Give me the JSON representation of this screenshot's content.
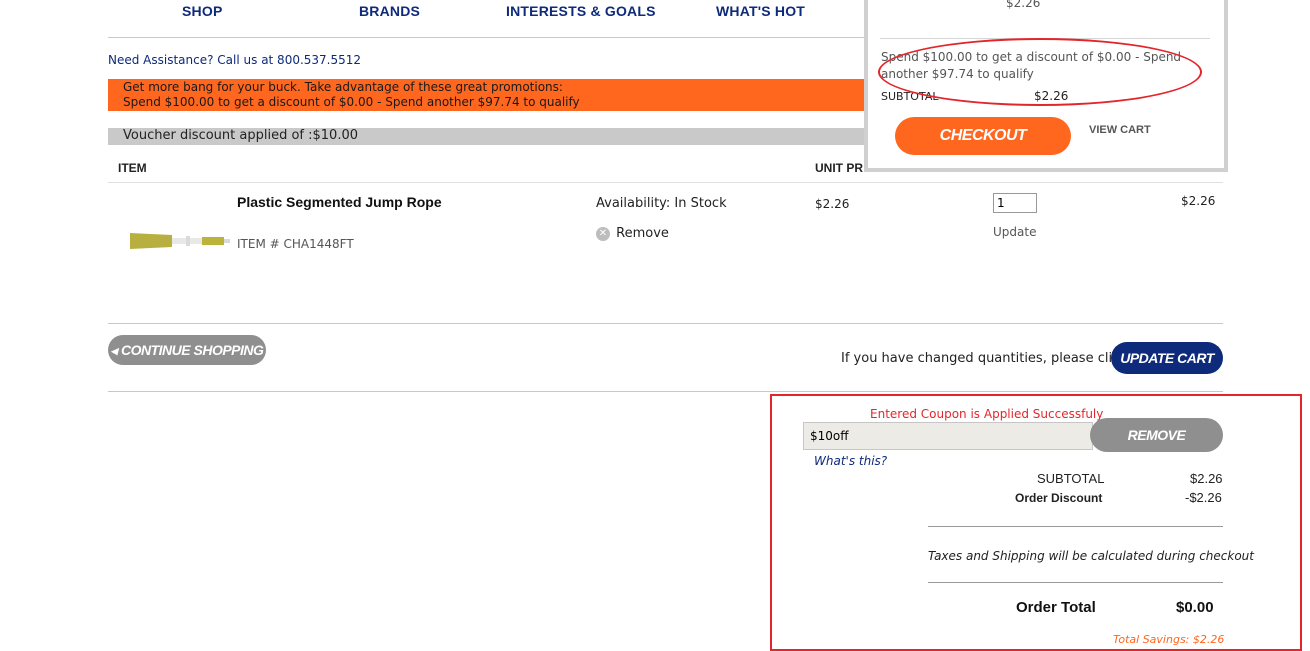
{
  "nav": {
    "items": [
      "SHOP",
      "BRANDS",
      "INTERESTS & GOALS",
      "WHAT'S HOT"
    ]
  },
  "assist": "Need Assistance? Call us at 800.537.5512",
  "promo": {
    "line1": "Get more bang for your buck. Take advantage of these great promotions:",
    "line2": "Spend $100.00 to get a discount of $0.00 - Spend another $97.74 to qualify"
  },
  "voucher_text": "Voucher discount applied of :$10.00",
  "table": {
    "col_item": "ITEM",
    "col_unit": "UNIT PR",
    "col_qty": "-"
  },
  "cart_item": {
    "name": "Plastic Segmented Jump Rope",
    "item_no": "ITEM # CHA1448FT",
    "availability": "Availability: In Stock",
    "remove": "Remove",
    "unit_price": "$2.26",
    "qty": "1",
    "update": "Update",
    "total": "$2.26"
  },
  "continue_label": "CONTINUE SHOPPING",
  "changed_qty_text": "If you have changed quantities, please click:",
  "update_cart_label": "UPDATE CART",
  "coupon": {
    "success": "Entered Coupon is Applied Successfuly",
    "value": "$10off",
    "remove_label": "REMOVE",
    "whats_this": "What's this?"
  },
  "summary": {
    "subtotal_label": "SUBTOTAL",
    "subtotal_value": "$2.26",
    "discount_label": "Order Discount",
    "discount_value": "-$2.26",
    "taxes_note": "Taxes and Shipping will be calculated during checkout",
    "total_label": "Order Total",
    "total_value": "$0.00",
    "savings": "Total Savings: $2.26"
  },
  "minicart": {
    "top_price": "$2.26",
    "promo_text": "Spend $100.00 to get a discount of $0.00 - Spend another $97.74 to qualify",
    "subtotal_label": "SUBTOTAL",
    "subtotal_value": "$2.26",
    "checkout_label": "CHECKOUT",
    "view_cart_label": "VIEW CART"
  },
  "colors": {
    "navy": "#0e2a7a",
    "orange": "#ff671f",
    "red": "#e3262b",
    "gray_button": "#8f8f8f"
  }
}
